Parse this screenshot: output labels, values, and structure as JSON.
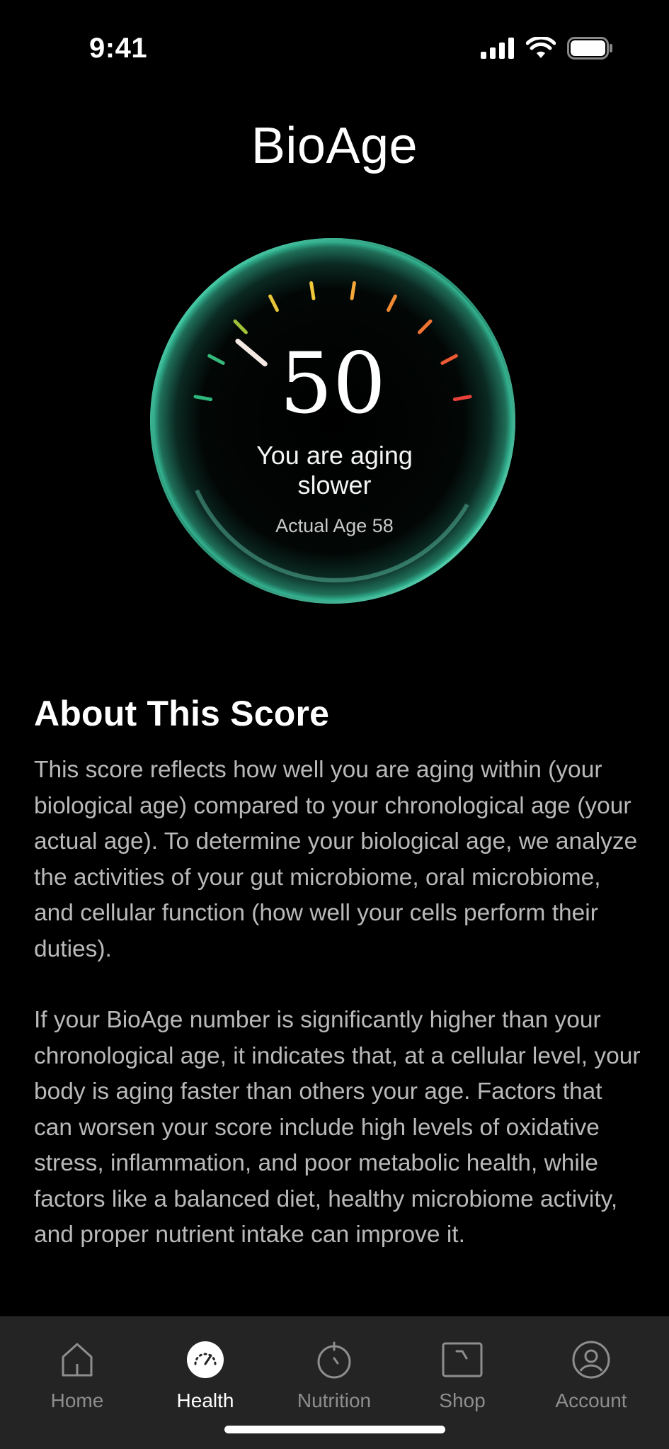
{
  "status_bar": {
    "time": "9:41"
  },
  "header": {
    "title": "BioAge"
  },
  "gauge": {
    "value": "50",
    "status": "You are aging slower",
    "subtitle": "Actual Age 58",
    "tick_colors": [
      "#2fb67a",
      "#36b87a",
      "#9fc23a",
      "#e5c43a",
      "#f0c93a",
      "#f5a93a",
      "#f08a32",
      "#ef7331",
      "#ec5a34",
      "#e8423b"
    ],
    "ring_color": "#3ddbb0",
    "needle_color": "#f5e9e4"
  },
  "about": {
    "heading": "About This Score",
    "paragraphs": [
      "This score reflects how well you are aging within (your biological age) compared to your chronological age (your actual age). To determine your biological age, we analyze the activities of your gut microbiome, oral microbiome, and cellular function (how well your cells perform their duties).",
      "If your BioAge number is significantly higher than your chronological age, it indicates that, at a cellular level, your body is aging faster than others your age. Factors that can worsen your score include high levels of oxidative stress, inflammation, and poor metabolic health, while factors like a balanced diet, healthy microbiome activity, and proper nutrient intake can improve it."
    ]
  },
  "tabbar": {
    "tabs": [
      {
        "label": "Home",
        "icon": "home-icon",
        "active": false
      },
      {
        "label": "Health",
        "icon": "gauge-icon",
        "active": true
      },
      {
        "label": "Nutrition",
        "icon": "apple-icon",
        "active": false
      },
      {
        "label": "Shop",
        "icon": "shop-icon",
        "active": false
      },
      {
        "label": "Account",
        "icon": "account-icon",
        "active": false
      }
    ]
  }
}
